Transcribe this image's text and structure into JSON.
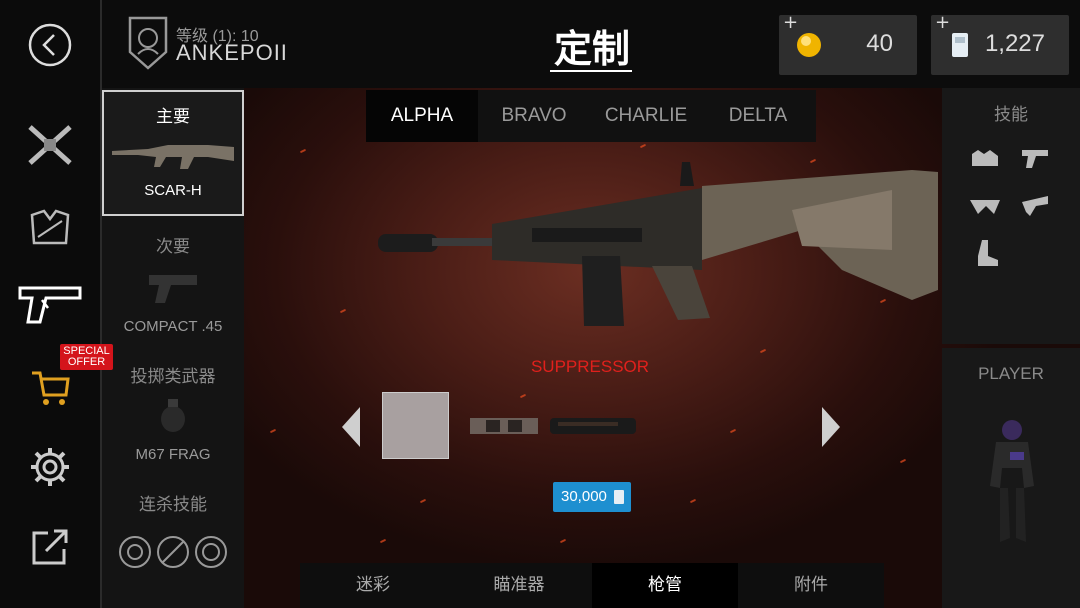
{
  "header": {
    "rank_label": "等级 (1): 10",
    "player_name": "ANKEPOII",
    "title": "定制",
    "coins": "40",
    "cards": "1,227",
    "plus": "+"
  },
  "tabs": [
    "ALPHA",
    "BRAVO",
    "CHARLIE",
    "DELTA"
  ],
  "active_tab": "ALPHA",
  "loadout": {
    "primary_title": "主要",
    "primary_name": "SCAR-H",
    "secondary_title": "次要",
    "secondary_name": "COMPACT .45",
    "throwable_title": "投掷类武器",
    "throwable_name": "M67 FRAG",
    "killstreak_title": "连杀技能"
  },
  "side": {
    "special_offer": "SPECIAL OFFER"
  },
  "right": {
    "skills_title": "技能",
    "player_title": "PLAYER"
  },
  "center": {
    "attachment_name": "SUPPRESSOR",
    "price": "30,000"
  },
  "bottom_tabs": [
    "迷彩",
    "瞄准器",
    "枪管",
    "附件"
  ],
  "active_bottom_tab": "枪管",
  "colors": {
    "accent_red": "#e0201c",
    "price_blue": "#1e8fd0",
    "offer_red": "#d4141b"
  }
}
